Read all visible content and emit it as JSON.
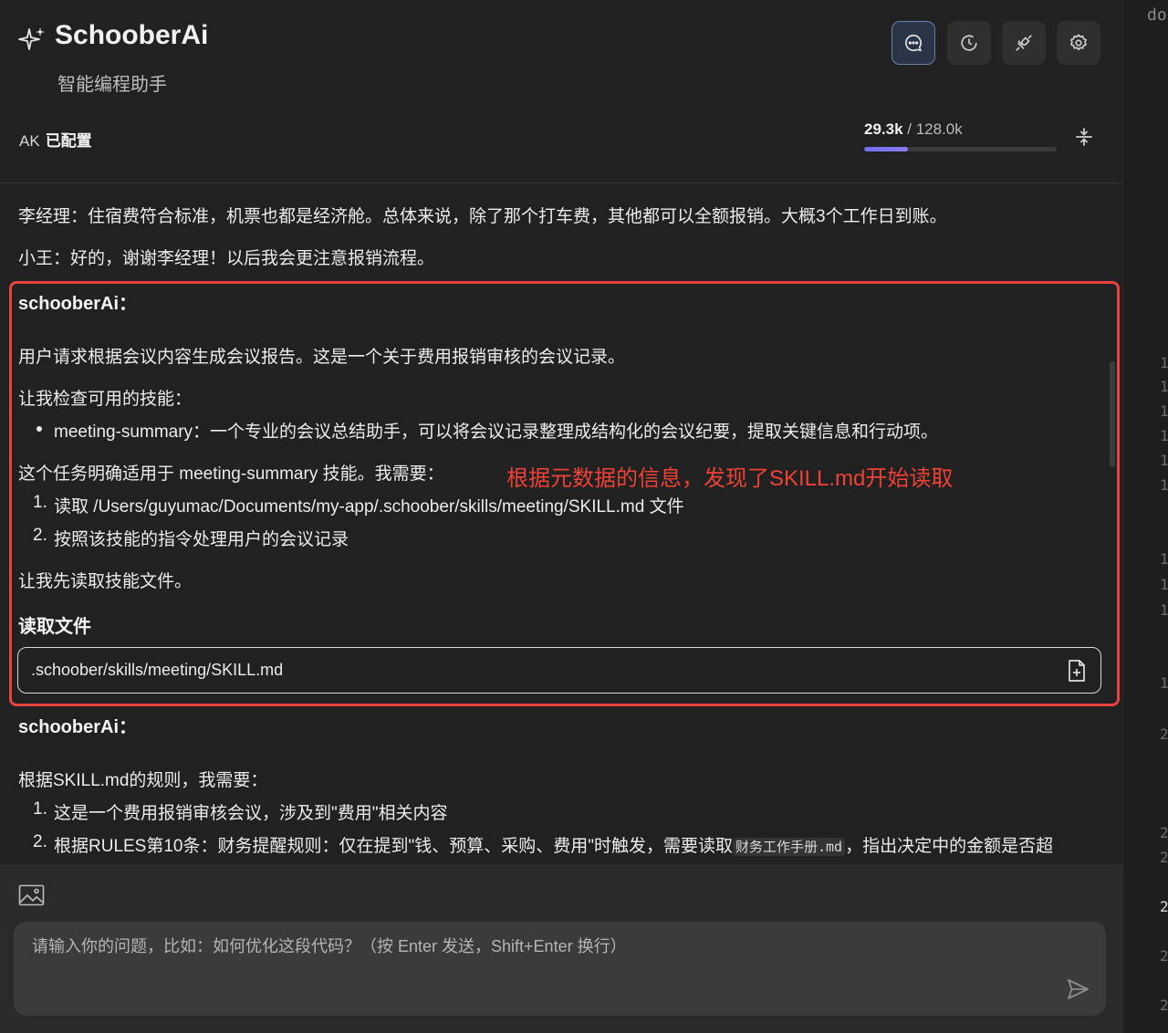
{
  "app": {
    "title": "SchooberAi",
    "subtitle": "智能编程助手"
  },
  "toolbar": {
    "buttons": [
      {
        "name": "chat",
        "icon": "chat-bubble-icon",
        "active": true
      },
      {
        "name": "history",
        "icon": "history-icon",
        "active": false
      },
      {
        "name": "connect",
        "icon": "plug-icon",
        "active": false
      },
      {
        "name": "settings",
        "icon": "gear-icon",
        "active": false
      }
    ]
  },
  "status": {
    "ak_label": "AK",
    "ak_value": "已配置",
    "tokens_used": "29.3k",
    "tokens_sep": " / ",
    "tokens_total": "128.0k",
    "tokens_fraction": 0.229
  },
  "messages": {
    "line_manager": "李经理：住宿费符合标准，机票也都是经济舱。总体来说，除了那个打车费，其他都可以全额报销。大概3个工作日到账。",
    "line_xiaowang": "小王：好的，谢谢李经理！以后我会更注意报销流程。",
    "ai_name_1": "schooberAi：",
    "ai1_p1": "用户请求根据会议内容生成会议报告。这是一个关于费用报销审核的会议记录。",
    "ai1_p2": "让我检查可用的技能：",
    "ai1_bullet": "meeting-summary：一个专业的会议总结助手，可以将会议记录整理成结构化的会议纪要，提取关键信息和行动项。",
    "ai1_p3": "这个任务明确适用于 meeting-summary 技能。我需要：",
    "ai1_ol1_num": "1.",
    "ai1_ol1": "读取 /Users/guyumac/Documents/my-app/.schoober/skills/meeting/SKILL.md 文件",
    "ai1_ol2_num": "2.",
    "ai1_ol2": "按照该技能的指令处理用户的会议记录",
    "ai1_p4": "让我先读取技能文件。",
    "read_file_heading": "读取文件",
    "read_file_path": ".schoober/skills/meeting/SKILL.md",
    "ai_name_2": "schooberAi：",
    "ai2_p1": "根据SKILL.md的规则，我需要：",
    "ai2_ol1_num": "1.",
    "ai2_ol1": "这是一个费用报销审核会议，涉及到\"费用\"相关内容",
    "ai2_ol2_num": "2.",
    "ai2_ol2_a": "根据RULES第10条：财务提醒规则：仅在提到\"钱、预算、采购、费用\"时触发，需要读取",
    "ai2_ol2_code": "财务工作手册.md",
    "ai2_ol2_b": "，指出决定中的金额是否超"
  },
  "annotation": {
    "text": "根据元数据的信息，发现了SKILL.md开始读取",
    "color": "#ef4135"
  },
  "input": {
    "placeholder": "请输入你的问题，比如：如何优化这段代码？（按 Enter 发送，Shift+Enter 换行）",
    "image_icon": "image-icon",
    "send_icon": "send-icon"
  },
  "side_panel": {
    "word": "do",
    "line_numbers": [
      "1",
      "1",
      "1",
      "1",
      "1",
      "1",
      "1",
      "1",
      "1",
      "1",
      "2",
      "2",
      "2",
      "2",
      "2",
      "2"
    ]
  },
  "colors": {
    "accent": "#6d6ff5",
    "annotation": "#ef4135",
    "background": "#212121"
  }
}
